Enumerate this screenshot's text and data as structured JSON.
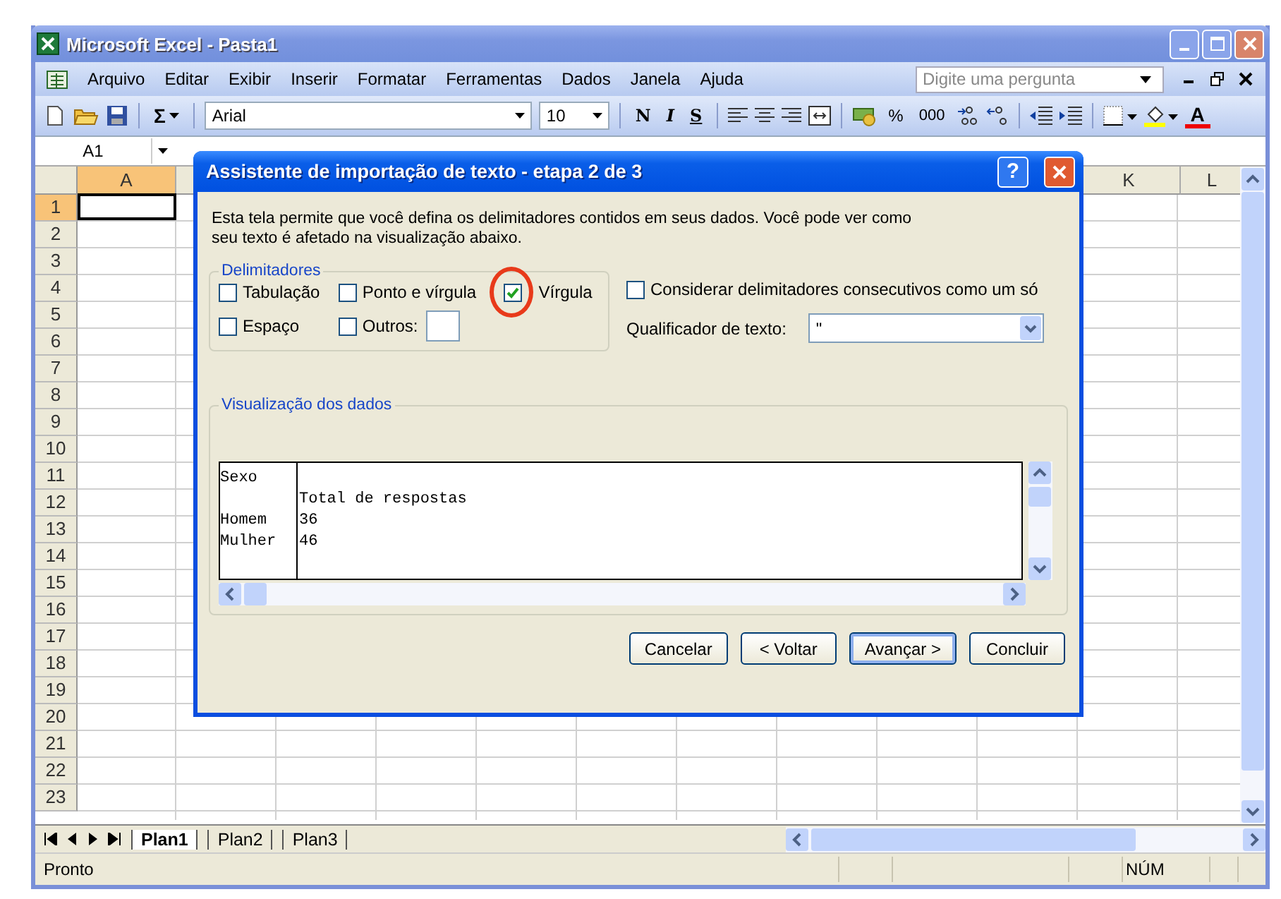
{
  "window": {
    "title": "Microsoft Excel - Pasta1"
  },
  "menu": {
    "items": [
      "Arquivo",
      "Editar",
      "Exibir",
      "Inserir",
      "Formatar",
      "Ferramentas",
      "Dados",
      "Janela",
      "Ajuda"
    ],
    "help_search": {
      "placeholder": "Digite uma pergunta"
    }
  },
  "toolbar": {
    "items": [
      {
        "kind": "new"
      },
      {
        "kind": "open"
      },
      {
        "kind": "save"
      },
      {
        "kind": "sep"
      },
      {
        "kind": "sum",
        "text": "Σ"
      },
      {
        "kind": "sep"
      },
      {
        "kind": "font",
        "text": "Arial"
      },
      {
        "kind": "size",
        "text": "10"
      },
      {
        "kind": "sep"
      },
      {
        "kind": "bold",
        "text": "N"
      },
      {
        "kind": "italic",
        "text": "I"
      },
      {
        "kind": "underline",
        "text": "S"
      },
      {
        "kind": "sep"
      },
      {
        "kind": "alignleft"
      },
      {
        "kind": "center"
      },
      {
        "kind": "alignright"
      },
      {
        "kind": "merge"
      },
      {
        "kind": "sep"
      },
      {
        "kind": "currency"
      },
      {
        "kind": "percent",
        "text": "%"
      },
      {
        "kind": "thousands",
        "text": "000"
      },
      {
        "kind": "incdecimal"
      },
      {
        "kind": "decdecimal"
      },
      {
        "kind": "sep"
      },
      {
        "kind": "outdent"
      },
      {
        "kind": "indent"
      },
      {
        "kind": "sep"
      },
      {
        "kind": "borders"
      },
      {
        "kind": "fill"
      },
      {
        "kind": "fontcolor",
        "text": "A"
      }
    ]
  },
  "name_box": "A1",
  "sheet": {
    "columns": [
      {
        "label": "A",
        "selected": true
      },
      {
        "label": "K",
        "selected": false
      },
      {
        "label": "L",
        "selected": false
      }
    ],
    "rows": [
      {
        "label": "1",
        "selected": true
      },
      {
        "label": "2",
        "selected": false
      },
      {
        "label": "3",
        "selected": false
      },
      {
        "label": "4",
        "selected": false
      },
      {
        "label": "5",
        "selected": false
      },
      {
        "label": "6",
        "selected": false
      },
      {
        "label": "7",
        "selected": false
      },
      {
        "label": "8",
        "selected": false
      },
      {
        "label": "9",
        "selected": false
      },
      {
        "label": "10",
        "selected": false
      },
      {
        "label": "11",
        "selected": false
      },
      {
        "label": "12",
        "selected": false
      },
      {
        "label": "13",
        "selected": false
      },
      {
        "label": "14",
        "selected": false
      },
      {
        "label": "15",
        "selected": false
      },
      {
        "label": "16",
        "selected": false
      },
      {
        "label": "17",
        "selected": false
      },
      {
        "label": "18",
        "selected": false
      },
      {
        "label": "19",
        "selected": false
      },
      {
        "label": "20",
        "selected": false
      },
      {
        "label": "21",
        "selected": false
      },
      {
        "label": "22",
        "selected": false
      },
      {
        "label": "23",
        "selected": false
      }
    ]
  },
  "dialog": {
    "title": "Assistente de importação de texto - etapa 2 de 3",
    "help_label": "?",
    "description": "Esta tela permite que você defina os delimitadores contidos em seus dados. Você pode ver como seu texto é afetado na visualização abaixo.",
    "delimiters": {
      "title": "Delimitadores",
      "options": [
        {
          "label": "Tabulação",
          "checked": false
        },
        {
          "label": "Ponto e vírgula",
          "checked": false
        },
        {
          "label": "Vírgula",
          "checked": true
        },
        {
          "label": "Espaço",
          "checked": false
        },
        {
          "label": "Outros:",
          "checked": false
        }
      ]
    },
    "consecutive": {
      "label": "Considerar delimitadores consecutivos como um só",
      "checked": false
    },
    "qualifier": {
      "label": "Qualificador de texto:",
      "value": "\""
    },
    "preview": {
      "title": "Visualização dos dados",
      "rows": [
        [
          "Sexo",
          ""
        ],
        [
          "",
          "Total de respostas"
        ],
        [
          "Homem",
          "36"
        ],
        [
          "Mulher",
          "46"
        ]
      ]
    },
    "buttons": [
      {
        "label": "Cancelar",
        "default": false
      },
      {
        "label": "< Voltar",
        "default": false
      },
      {
        "label": "Avançar >",
        "default": true
      },
      {
        "label": "Concluir",
        "default": false
      }
    ]
  },
  "sheet_tabs": [
    {
      "label": "Plan1",
      "selected": true
    },
    {
      "label": "Plan2",
      "selected": false
    },
    {
      "label": "Plan3",
      "selected": false
    }
  ],
  "status_bar": {
    "text": "Pronto",
    "indicators": [
      "NÚM"
    ]
  }
}
